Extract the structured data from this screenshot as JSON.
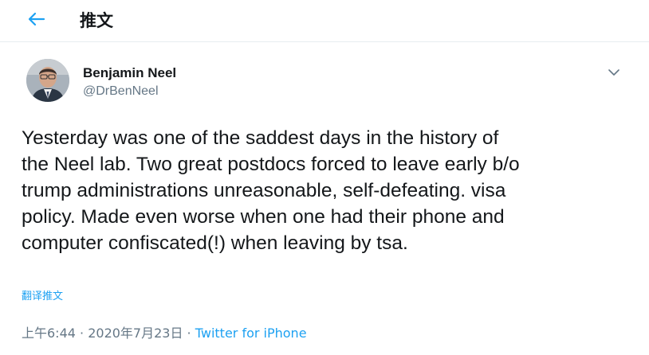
{
  "header": {
    "title": "推文"
  },
  "tweet": {
    "author_name": "Benjamin Neel",
    "author_handle": "@DrBenNeel",
    "lines": [
      "Yesterday was one of the saddest days in the history of",
      "the Neel lab. Two great postdocs forced to leave early b/o",
      "trump administrations unreasonable, self-defeating. visa",
      "policy. Made even worse when one had their phone and",
      "computer confiscated(!) when leaving by tsa."
    ],
    "translate_label": "翻译推文",
    "time": "上午6:44",
    "separator": " · ",
    "date": "2020年7月23日",
    "source": "Twitter for iPhone"
  },
  "colors": {
    "accent": "#1da1f2",
    "text": "#14171a",
    "muted": "#657786"
  },
  "icons": {
    "back": "arrow-left-icon",
    "more": "chevron-down-icon"
  }
}
